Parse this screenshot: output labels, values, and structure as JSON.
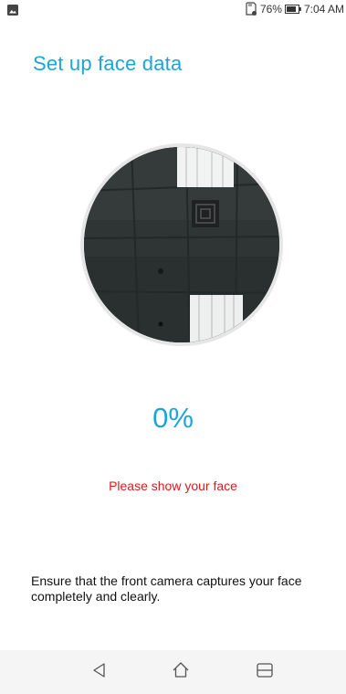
{
  "status_bar": {
    "battery_percent": "76%",
    "time": "7:04 AM",
    "icons": [
      "image-notification-icon",
      "sd-card-icon",
      "battery-icon"
    ]
  },
  "title": "Set up face data",
  "progress": {
    "value": 0,
    "label": "0%"
  },
  "prompt": "Please show your face",
  "instruction": "Ensure that the front camera captures your face completely and clearly.",
  "nav_bar": {
    "icons": [
      "back-icon",
      "home-icon",
      "recent-apps-icon"
    ]
  },
  "colors": {
    "accent": "#1ba5d8",
    "warning": "#d81b1b",
    "nav_background": "#f5f5f5"
  }
}
